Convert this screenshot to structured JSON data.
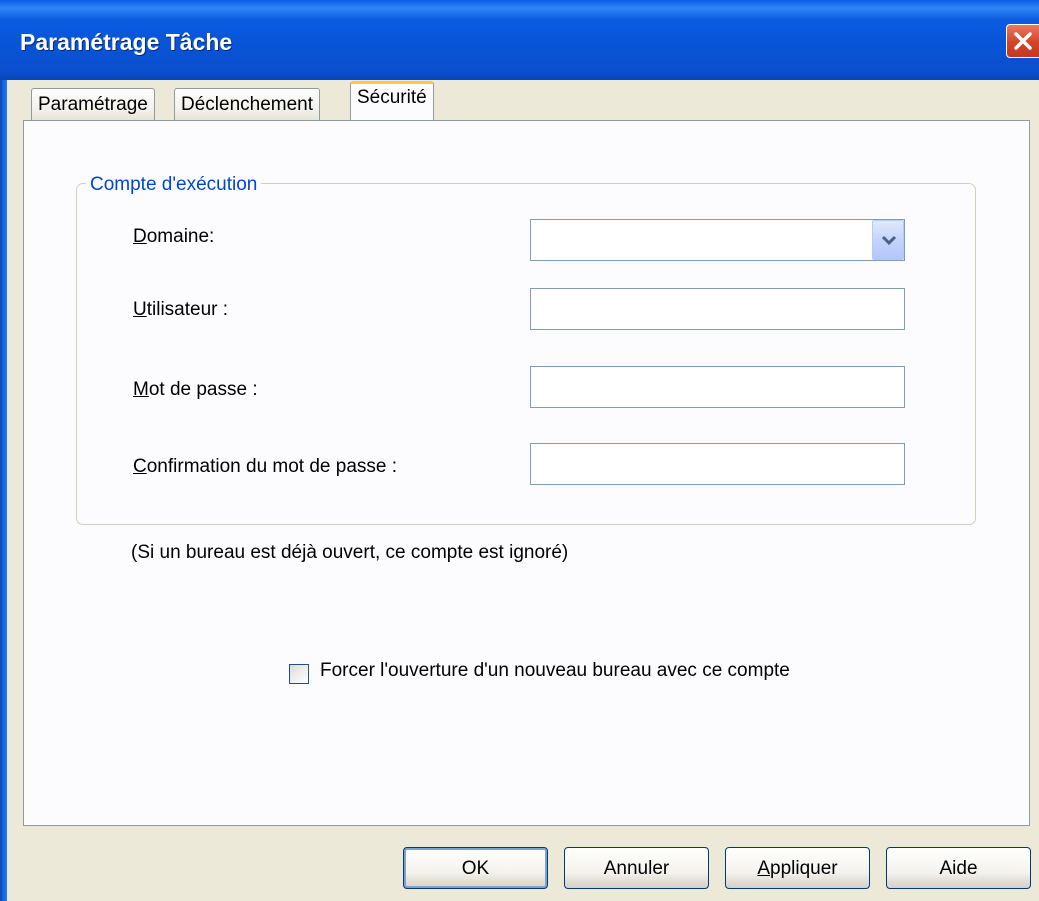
{
  "window": {
    "title": "Paramétrage Tâche"
  },
  "tabs": [
    {
      "label": "Paramétrage"
    },
    {
      "label": "Déclenchement"
    },
    {
      "label": "Sécurité",
      "active": true
    }
  ],
  "account_group": {
    "legend": "Compte d'exécution",
    "domain": {
      "label_first": "D",
      "label_rest": "omaine:",
      "value": ""
    },
    "user": {
      "label_first": "U",
      "label_rest": "tilisateur :",
      "value": ""
    },
    "password": {
      "label_first": "M",
      "label_rest": "ot de passe :",
      "value": ""
    },
    "confirm": {
      "label_first": "C",
      "label_rest": "onfirmation du mot de passe :",
      "value": ""
    }
  },
  "note": "(Si un bureau est déjà ouvert, ce compte est ignoré)",
  "force_desktop": {
    "label": "Forcer l'ouverture d'un nouveau bureau avec ce compte",
    "checked": false
  },
  "buttons": {
    "ok": "OK",
    "cancel": "Annuler",
    "apply_first": "A",
    "apply_rest": "ppliquer",
    "help": "Aide"
  },
  "colors": {
    "titlebar": "#0853d6",
    "dialog_bg": "#ece9d8",
    "group_legend": "#0046d5",
    "active_tab_accent": "#ffc83c"
  },
  "icons": {
    "close": "close-icon",
    "dropdown": "chevron-down-icon"
  }
}
